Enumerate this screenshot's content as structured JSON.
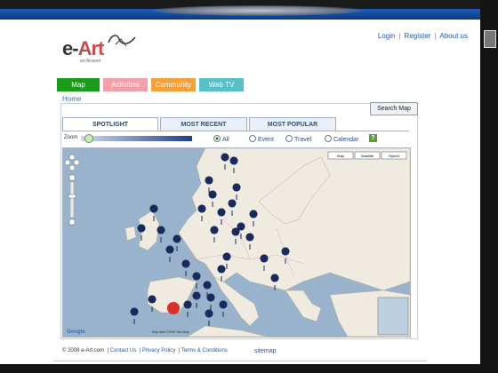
{
  "logo": {
    "text_main": "e-",
    "text_accent": "Art",
    "tagline": "art Around"
  },
  "top_links": [
    "Login",
    "Register",
    "About us"
  ],
  "nav_tabs": [
    {
      "label": "Map",
      "color": "#1a9a1a"
    },
    {
      "label": "Activities",
      "color": "#f0a0a8"
    },
    {
      "label": "Community",
      "color": "#f5a03a"
    },
    {
      "label": "Web TV",
      "color": "#5ac0c8"
    }
  ],
  "breadcrumb": "Home",
  "search_button": "Search Map",
  "panel_tabs": [
    "SPOTLIGHT",
    "MOST RECENT",
    "MOST POPULAR"
  ],
  "zoom_label": "Zoom",
  "filters": [
    {
      "label": "All",
      "selected": true
    },
    {
      "label": "Event",
      "selected": false
    },
    {
      "label": "Travel",
      "selected": false
    },
    {
      "label": "Calendar",
      "selected": false
    }
  ],
  "help_icon": "?",
  "map": {
    "type_buttons": [
      "Map",
      "Satellite",
      "Hybrid"
    ],
    "google_label": "Google",
    "copyright": "Map data ©2008 Tele Atlas"
  },
  "footer": {
    "copyright": "© 2008 e-Art.com",
    "links": [
      "Contact Us",
      "Privacy Policy",
      "Terms & Conditions"
    ],
    "sitemap": "sitemap"
  },
  "colors": {
    "marker": "#1b2a5c",
    "marker_selected": "#d9302a",
    "sea": "#99b3cc",
    "land": "#efebe0"
  }
}
